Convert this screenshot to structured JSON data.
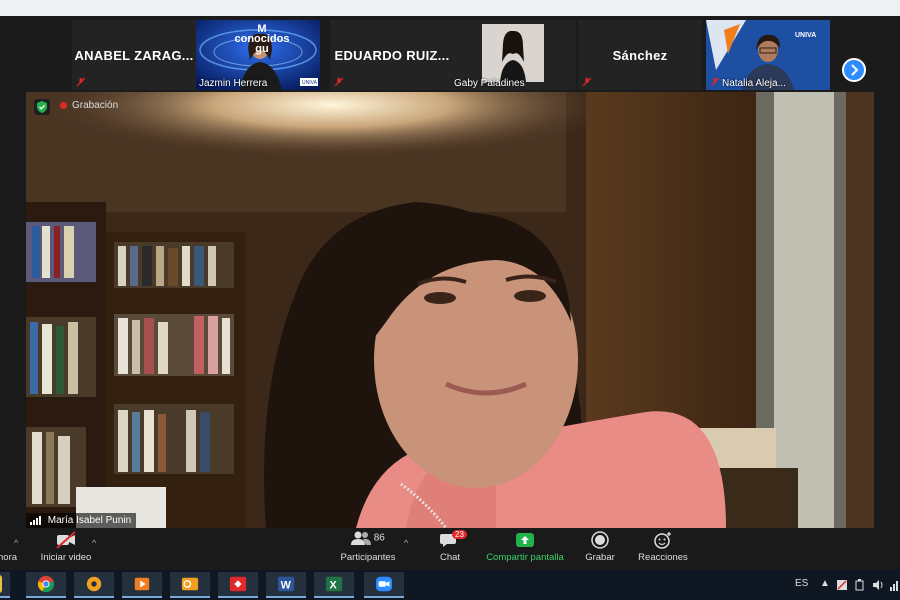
{
  "gallery": {
    "tiles": [
      {
        "name": "ANABEL ZARAG...",
        "muted": true
      },
      {
        "label": "Jazmin Herrera",
        "muted": false,
        "overlay_text": "M conocidos gu",
        "logo": "UNIVA"
      },
      {
        "name": "EDUARDO  RUIZ...",
        "muted": true
      },
      {
        "label": "Gaby Paladines",
        "muted": false
      },
      {
        "name": "Sánchez",
        "muted": false
      },
      {
        "label": "Natalia Aleja...",
        "muted": true,
        "logo": "UNIVA"
      }
    ],
    "next_icon": "chevron-right-icon"
  },
  "main": {
    "recording_label": "Grabación",
    "speaker_name": "María Isabel Punin"
  },
  "toolbar": {
    "ahora": "hora",
    "video": "Iniciar video",
    "participants": "Participantes",
    "participants_count": "86",
    "chat": "Chat",
    "chat_badge": "23",
    "share": "Compartir pantalla",
    "record": "Grabar",
    "reactions": "Reacciones"
  },
  "taskbar": {
    "language": "ES",
    "apps": [
      "chrome",
      "settings",
      "media-player",
      "outlook",
      "anydesk",
      "word",
      "excel",
      "zoom"
    ]
  },
  "colors": {
    "accent": "#2d8cff",
    "share_green": "#22b14c",
    "recording_red": "#e02828"
  }
}
